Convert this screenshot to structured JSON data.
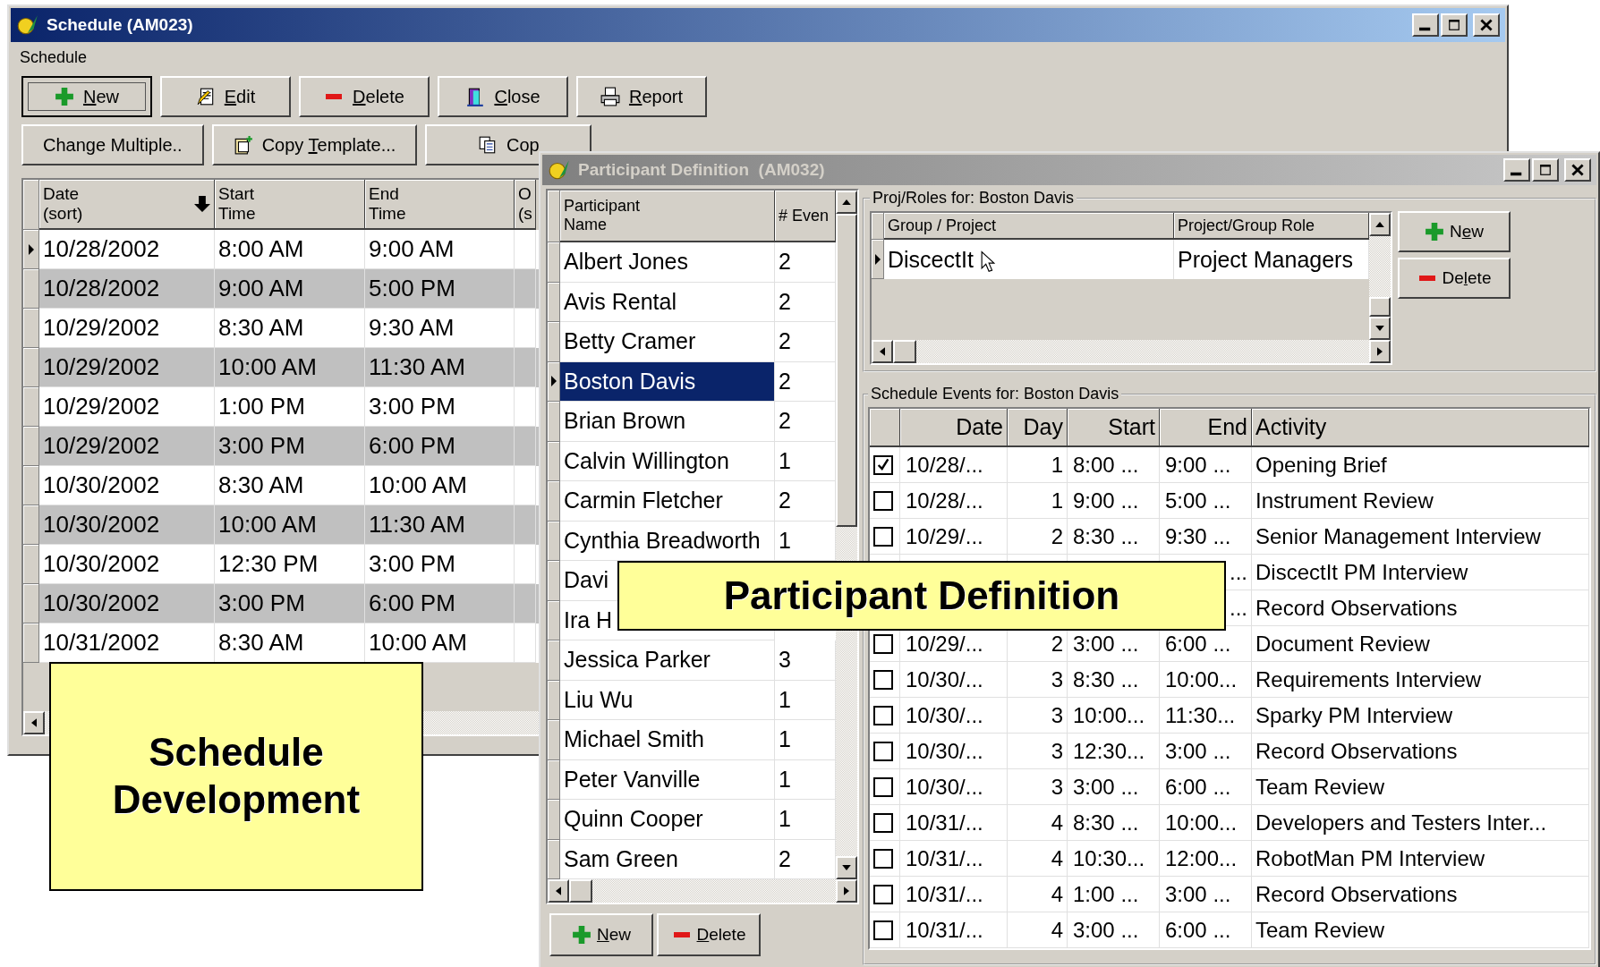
{
  "schedule_window": {
    "title": "Schedule (AM023)",
    "active": true,
    "menu": [
      "Schedule"
    ],
    "toolbar_rows": [
      [
        {
          "key": "N",
          "post": "ew",
          "kind": "new",
          "focused": true
        },
        {
          "key": "E",
          "post": "dit",
          "kind": "edit",
          "focused": false
        },
        {
          "key": "D",
          "post": "elete",
          "kind": "delete",
          "focused": false
        },
        {
          "key": "C",
          "post": "lose",
          "kind": "close",
          "focused": false
        },
        {
          "key": "R",
          "post": "eport",
          "kind": "report",
          "focused": false
        }
      ],
      [
        {
          "pre": "Change Multiple..",
          "focused": false
        },
        {
          "pre": "Copy ",
          "key": "T",
          "post": "emplate...",
          "kind": "template",
          "focused": false
        },
        {
          "pre": "Cop",
          "kind": "copy",
          "focused": false
        }
      ]
    ],
    "table": {
      "columns": [
        {
          "lines": [
            "Date",
            "(sort)"
          ],
          "sorted": true
        },
        {
          "lines": [
            "Start",
            "Time"
          ],
          "sorted": false
        },
        {
          "lines": [
            "End",
            "Time"
          ],
          "sorted": false
        },
        {
          "lines": [
            "O",
            "(s"
          ]
        }
      ],
      "rows": [
        {
          "cells": [
            "10/28/2002",
            "8:00 AM",
            "9:00 AM"
          ],
          "selected": true
        },
        {
          "cells": [
            "10/28/2002",
            "9:00 AM",
            "5:00 PM"
          ],
          "selected": false
        },
        {
          "cells": [
            "10/29/2002",
            "8:30 AM",
            "9:30 AM"
          ],
          "selected": false
        },
        {
          "cells": [
            "10/29/2002",
            "10:00 AM",
            "11:30 AM"
          ],
          "selected": false
        },
        {
          "cells": [
            "10/29/2002",
            "1:00 PM",
            "3:00 PM"
          ],
          "selected": false
        },
        {
          "cells": [
            "10/29/2002",
            "3:00 PM",
            "6:00 PM"
          ],
          "selected": false
        },
        {
          "cells": [
            "10/30/2002",
            "8:30 AM",
            "10:00 AM"
          ],
          "selected": false
        },
        {
          "cells": [
            "10/30/2002",
            "10:00 AM",
            "11:30 AM"
          ],
          "selected": false
        },
        {
          "cells": [
            "10/30/2002",
            "12:30 PM",
            "3:00 PM"
          ],
          "selected": false
        },
        {
          "cells": [
            "10/30/2002",
            "3:00 PM",
            "6:00 PM"
          ],
          "selected": false
        },
        {
          "cells": [
            "10/31/2002",
            "8:30 AM",
            "10:00 AM"
          ],
          "selected": false
        }
      ]
    }
  },
  "participant_window": {
    "title": "Participant Definition  (AM032)",
    "active": false,
    "participants": {
      "columns": [
        {
          "lines": [
            "Participant",
            "Name"
          ]
        },
        {
          "lines": [
            "# Even"
          ]
        }
      ],
      "rows": [
        {
          "name": "Albert Jones",
          "events": "2",
          "selected": false
        },
        {
          "name": "Avis Rental",
          "events": "2",
          "selected": false
        },
        {
          "name": "Betty Cramer",
          "events": "2",
          "selected": false
        },
        {
          "name": "Boston Davis",
          "events": "2",
          "selected": true
        },
        {
          "name": "Brian Brown",
          "events": "2",
          "selected": false
        },
        {
          "name": "Calvin Willington",
          "events": "1",
          "selected": false
        },
        {
          "name": "Carmin Fletcher",
          "events": "2",
          "selected": false
        },
        {
          "name": "Cynthia Breadworth",
          "events": "1",
          "selected": false
        },
        {
          "name": "Davi",
          "selected": false
        },
        {
          "name": "Ira H",
          "selected": false
        },
        {
          "name": "Jessica Parker",
          "events": "3",
          "selected": false
        },
        {
          "name": "Liu Wu",
          "events": "1",
          "selected": false
        },
        {
          "name": "Michael Smith",
          "events": "1",
          "selected": false
        },
        {
          "name": "Peter Vanville",
          "events": "1",
          "selected": false
        },
        {
          "name": "Quinn Cooper",
          "events": "1",
          "selected": false
        },
        {
          "name": "Sam Green",
          "events": "2",
          "selected": false
        }
      ],
      "buttons": [
        {
          "key": "N",
          "post": "ew",
          "kind": "new"
        },
        {
          "key": "D",
          "post": "elete",
          "kind": "delete"
        }
      ]
    },
    "roles": {
      "title": "Proj/Roles for: Boston Davis",
      "columns": [
        "Group / Project",
        "Project/Group Role"
      ],
      "rows": [
        {
          "cells": [
            "DiscectIt",
            "Project Managers"
          ],
          "selected": true
        }
      ],
      "buttons": [
        {
          "pre": "N",
          "key": "e",
          "post": "w",
          "kind": "new"
        },
        {
          "pre": "De",
          "key": "l",
          "post": "ete",
          "kind": "delete"
        }
      ]
    },
    "events": {
      "title": "Schedule Events for: Boston Davis",
      "columns": [
        "Date",
        "Day",
        "Start",
        "End",
        "Activity"
      ],
      "rows": [
        {
          "checked": true,
          "date": "10/28/...",
          "day": "1",
          "start": "8:00 ...",
          "end": "9:00 ...",
          "activity": "Opening Brief"
        },
        {
          "checked": false,
          "date": "10/28/...",
          "day": "1",
          "start": "9:00 ...",
          "end": "5:00 ...",
          "activity": "Instrument Review"
        },
        {
          "checked": false,
          "date": "10/29/...",
          "day": "2",
          "start": "8:30 ...",
          "end": "9:30 ...",
          "activity": "Senior Management Interview"
        },
        {
          "end": "...",
          "activity": "DiscectIt PM Interview"
        },
        {
          "end": "...",
          "activity": "Record Observations"
        },
        {
          "checked": false,
          "date": "10/29/...",
          "day": "2",
          "start": "3:00 ...",
          "end": "6:00 ...",
          "activity": "Document Review"
        },
        {
          "checked": false,
          "date": "10/30/...",
          "day": "3",
          "start": "8:30 ...",
          "end": "10:00...",
          "activity": "Requirements Interview"
        },
        {
          "checked": false,
          "date": "10/30/...",
          "day": "3",
          "start": "10:00...",
          "end": "11:30...",
          "activity": "Sparky PM Interview"
        },
        {
          "checked": false,
          "date": "10/30/...",
          "day": "3",
          "start": "12:30...",
          "end": "3:00 ...",
          "activity": "Record Observations"
        },
        {
          "checked": false,
          "date": "10/30/...",
          "day": "3",
          "start": "3:00 ...",
          "end": "6:00 ...",
          "activity": "Team Review"
        },
        {
          "checked": false,
          "date": "10/31/...",
          "day": "4",
          "start": "8:30 ...",
          "end": "10:00...",
          "activity": "Developers and Testers Inter..."
        },
        {
          "checked": false,
          "date": "10/31/...",
          "day": "4",
          "start": "10:30...",
          "end": "12:00...",
          "activity": "RobotMan PM Interview"
        },
        {
          "checked": false,
          "date": "10/31/...",
          "day": "4",
          "start": "1:00 ...",
          "end": "3:00 ...",
          "activity": "Record Observations"
        },
        {
          "checked": false,
          "date": "10/31/...",
          "day": "4",
          "start": "3:00 ...",
          "end": "6:00 ...",
          "activity": "Team Review"
        }
      ]
    }
  },
  "callouts": [
    {
      "text": "Schedule Development"
    },
    {
      "text": "Participant Definition"
    }
  ]
}
